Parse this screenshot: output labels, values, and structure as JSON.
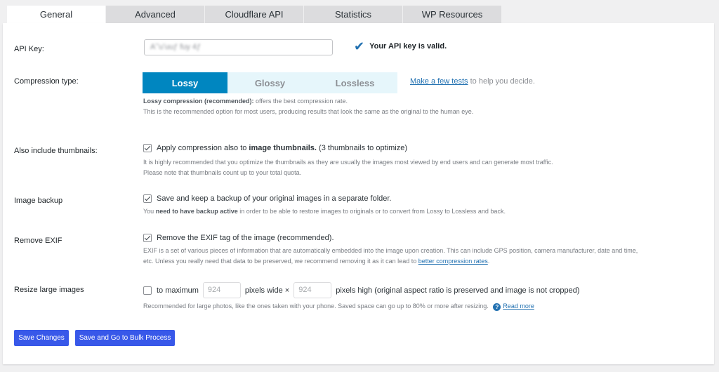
{
  "tabs": [
    {
      "label": "General",
      "active": true
    },
    {
      "label": "Advanced",
      "active": false
    },
    {
      "label": "Cloudflare API",
      "active": false
    },
    {
      "label": "Statistics",
      "active": false
    },
    {
      "label": "WP Resources",
      "active": false
    }
  ],
  "api_key": {
    "label": "API Key:",
    "value": "Aʼʼuʼuuƒ fuy 4ƒ",
    "valid_text": "Your API key is valid.",
    "valid_icon": "checkmark-icon"
  },
  "compression": {
    "label": "Compression type:",
    "options": [
      "Lossy",
      "Glossy",
      "Lossless"
    ],
    "selected": "Lossy",
    "tests_link": "Make a few tests",
    "tests_suffix": " to help you decide.",
    "desc_bold": "Lossy compression (recommended):",
    "desc_rest": " offers the best compression rate.",
    "desc_line2": "This is the recommended option for most users, producing results that look the same as the original to the human eye."
  },
  "thumbnails": {
    "label": "Also include thumbnails:",
    "checked": true,
    "text_pre": "Apply compression also to ",
    "text_bold": "image thumbnails.",
    "text_count": " (3 thumbnails to optimize)",
    "desc_line1": "It is highly recommended that you optimize the thumbnails as they are usually the images most viewed by end users and can generate most traffic.",
    "desc_line2": "Please note that thumbnails count up to your total quota."
  },
  "backup": {
    "label": "Image backup",
    "checked": true,
    "text": "Save and keep a backup of your original images in a separate folder.",
    "desc_pre": "You ",
    "desc_bold": "need to have backup active",
    "desc_post": " in order to be able to restore images to originals or to convert from Lossy to Lossless and back."
  },
  "exif": {
    "label": "Remove EXIF",
    "checked": true,
    "text": "Remove the EXIF tag of the image (recommended).",
    "desc_line1": "EXIF is a set of various pieces of information that are automatically embedded into the image upon creation. This can include GPS position, camera manufacturer, date and time,",
    "desc_line2_pre": "etc. Unless you really need that data to be preserved, we recommend removing it as it can lead to ",
    "desc_link": "better compression rates",
    "desc_line2_post": "."
  },
  "resize": {
    "label": "Resize large images",
    "checked": false,
    "to_max": "to maximum",
    "width_value": "924",
    "wide_text": "pixels wide ×",
    "height_value": "924",
    "high_text": "pixels high (original aspect ratio is preserved and image is not cropped)",
    "desc": "Recommended for large photos, like the ones taken with your phone. Saved space can go up to 80% or more after resizing.",
    "help_icon": "?",
    "read_more": "Read more"
  },
  "buttons": {
    "save": "Save Changes",
    "save_bulk": "Save and Go to Bulk Process"
  },
  "colors": {
    "accent": "#0086c0",
    "button": "#3858e9",
    "link": "#2271b1"
  }
}
